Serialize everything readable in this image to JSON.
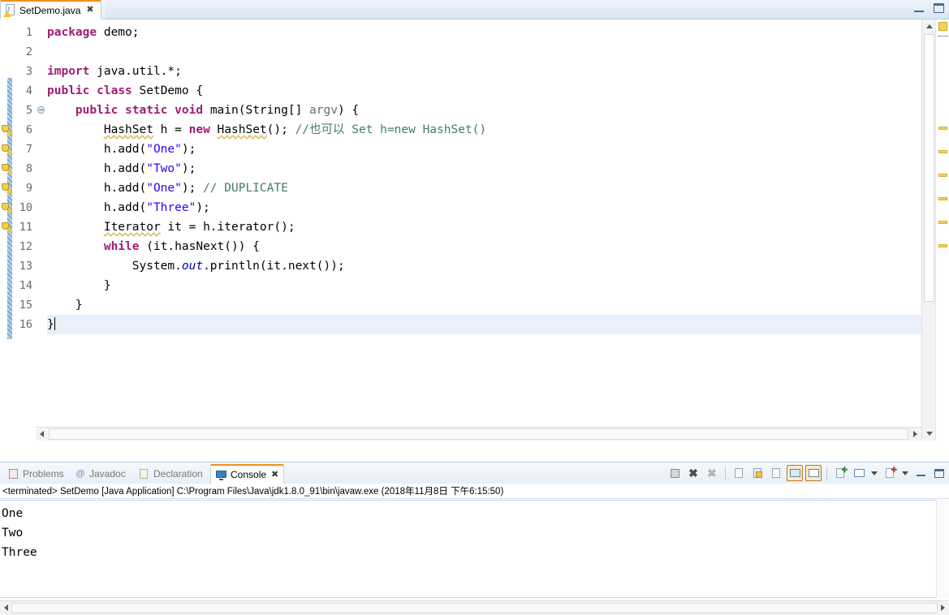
{
  "window": {
    "minimize_label": "Minimize",
    "maximize_label": "Maximize"
  },
  "editor_tab": {
    "title": "SetDemo.java",
    "close_label": "✖",
    "icon": "java-file-warning-icon"
  },
  "code": {
    "language": "java",
    "lines": [
      {
        "n": "1",
        "fold": false,
        "warn": false,
        "text": "package demo;"
      },
      {
        "n": "2",
        "fold": false,
        "warn": false,
        "text": ""
      },
      {
        "n": "3",
        "fold": false,
        "warn": false,
        "text": "import java.util.*;"
      },
      {
        "n": "4",
        "fold": false,
        "warn": false,
        "text": "public class SetDemo {"
      },
      {
        "n": "5",
        "fold": true,
        "warn": false,
        "text": "    public static void main(String[] argv) {"
      },
      {
        "n": "6",
        "fold": false,
        "warn": true,
        "text": "        HashSet h = new HashSet(); //也可以 Set h=new HashSet()"
      },
      {
        "n": "7",
        "fold": false,
        "warn": true,
        "text": "        h.add(\"One\");"
      },
      {
        "n": "8",
        "fold": false,
        "warn": true,
        "text": "        h.add(\"Two\");"
      },
      {
        "n": "9",
        "fold": false,
        "warn": true,
        "text": "        h.add(\"One\"); // DUPLICATE"
      },
      {
        "n": "10",
        "fold": false,
        "warn": true,
        "text": "        h.add(\"Three\");"
      },
      {
        "n": "11",
        "fold": false,
        "warn": true,
        "text": "        Iterator it = h.iterator();"
      },
      {
        "n": "12",
        "fold": false,
        "warn": false,
        "text": "        while (it.hasNext()) {"
      },
      {
        "n": "13",
        "fold": false,
        "warn": false,
        "text": "            System.out.println(it.next());"
      },
      {
        "n": "14",
        "fold": false,
        "warn": false,
        "text": "        }"
      },
      {
        "n": "15",
        "fold": false,
        "warn": false,
        "text": "    }"
      },
      {
        "n": "16",
        "fold": false,
        "warn": false,
        "text": "}"
      }
    ],
    "current_line": 16,
    "colors": {
      "keyword": "#a01d72",
      "string": "#2a00ff",
      "comment": "#3f7f5f",
      "static_field": "#0000c0",
      "unused_param": "#6a6a6a",
      "current_line_bg": "#e8f0fb"
    }
  },
  "bottom_panel": {
    "tabs": [
      {
        "label": "Problems",
        "icon": "problems-icon",
        "active": false
      },
      {
        "label": "Javadoc",
        "icon": "javadoc-icon",
        "active": false
      },
      {
        "label": "Declaration",
        "icon": "declaration-icon",
        "active": false
      },
      {
        "label": "Console",
        "icon": "console-icon",
        "active": true
      }
    ],
    "active_tab_close": "✖",
    "toolbar": [
      {
        "name": "terminate-button",
        "pressed": false
      },
      {
        "name": "remove-launch-button",
        "pressed": false
      },
      {
        "name": "remove-all-terminated-button",
        "pressed": false
      },
      {
        "name": "separator-1",
        "pressed": false
      },
      {
        "name": "clear-console-button",
        "pressed": false
      },
      {
        "name": "scroll-lock-button",
        "pressed": false
      },
      {
        "name": "word-wrap-button",
        "pressed": false
      },
      {
        "name": "show-console-on-output-button",
        "pressed": true
      },
      {
        "name": "show-console-on-error-button",
        "pressed": true
      },
      {
        "name": "separator-2",
        "pressed": false
      },
      {
        "name": "pin-console-button",
        "pressed": false
      },
      {
        "name": "display-selected-console-button",
        "pressed": false
      },
      {
        "name": "display-console-dropdown",
        "pressed": false
      },
      {
        "name": "open-console-button",
        "pressed": false
      },
      {
        "name": "open-console-dropdown",
        "pressed": false
      },
      {
        "name": "minimize-panel-button",
        "pressed": false
      },
      {
        "name": "maximize-panel-button",
        "pressed": false
      }
    ],
    "status_line": "<terminated> SetDemo [Java Application] C:\\Program Files\\Java\\jdk1.8.0_91\\bin\\javaw.exe (2018年11月8日 下午6:15:50)",
    "output_lines": [
      "One",
      "Two",
      "Three"
    ]
  }
}
